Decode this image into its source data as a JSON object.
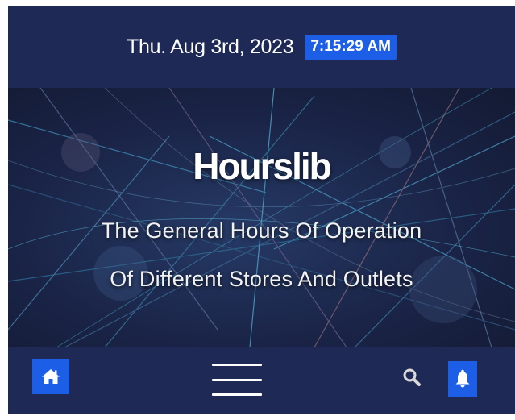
{
  "header": {
    "date": "Thu. Aug 3rd, 2023",
    "time": "7:15:29 AM"
  },
  "hero": {
    "title": "Hourslib",
    "subtitle_line1": "The General Hours Of Operation",
    "subtitle_line2": "Of Different Stores And Outlets"
  },
  "navbar": {
    "icons": {
      "home": "home-icon",
      "menu": "hamburger-menu-icon",
      "search": "search-icon",
      "notifications": "bell-icon"
    }
  },
  "colors": {
    "background": "#1e2a55",
    "accent": "#1c5ee6",
    "text": "#ffffff"
  }
}
